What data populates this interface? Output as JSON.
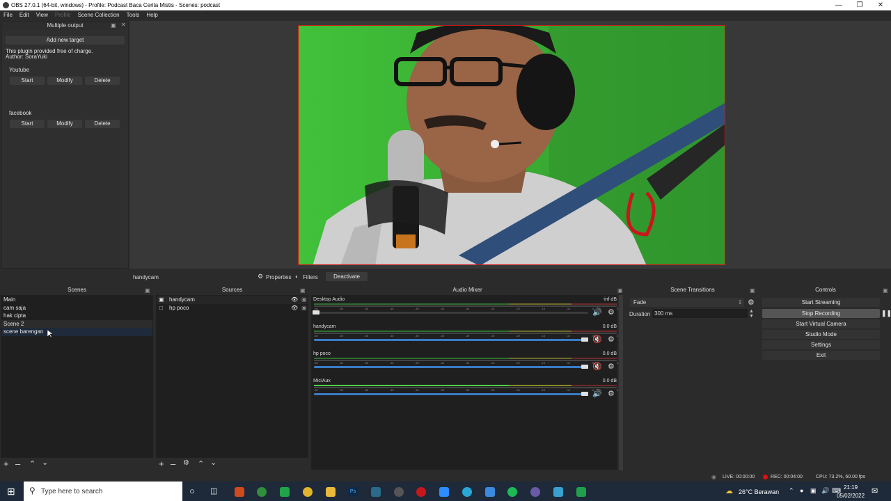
{
  "window": {
    "title": "OBS 27.0.1 (64-bit, windows) - Profile: Podcast Baca Cerita Mistis - Scenes: podcast"
  },
  "menu": {
    "items": [
      "File",
      "Edit",
      "View",
      "Profile",
      "Scene Collection",
      "Tools",
      "Help"
    ]
  },
  "multiple_output": {
    "title": "Multiple output",
    "add_label": "Add new target",
    "info_line1": "This plugin provided free of charge.",
    "info_line2": "Author: SoraYuki",
    "targets": [
      {
        "name": "Youtube",
        "start": "Start",
        "modify": "Modify",
        "delete": "Delete"
      },
      {
        "name": "facebook",
        "start": "Start",
        "modify": "Modify",
        "delete": "Delete"
      }
    ]
  },
  "source_toolbar": {
    "selected": "handycam",
    "properties": "Properties",
    "filters": "Filters",
    "deactivate": "Deactivate"
  },
  "scenes": {
    "title": "Scenes",
    "items": [
      "Main",
      "cam saja",
      "hak cipta",
      "Scene 2",
      "scene barengan"
    ]
  },
  "sources": {
    "title": "Sources",
    "items": [
      "handycam",
      "hp poco"
    ]
  },
  "mixer": {
    "title": "Audio Mixer",
    "channels": [
      {
        "name": "Desktop Audio",
        "db": "-inf dB",
        "level": 0.02,
        "muted": false
      },
      {
        "name": "handycam",
        "db": "0.0 dB",
        "level": 1.0,
        "muted": true
      },
      {
        "name": "hp poco",
        "db": "0.0 dB",
        "level": 1.0,
        "muted": true
      },
      {
        "name": "Mic/Aux",
        "db": "0.0 dB",
        "level": 1.0,
        "muted": false
      }
    ],
    "ticks": [
      "-60",
      "-55",
      "-50",
      "-45",
      "-40",
      "-35",
      "-30",
      "-25",
      "-20",
      "-15",
      "-10",
      "-5",
      "0"
    ]
  },
  "transitions": {
    "title": "Scene Transitions",
    "selected": "Fade",
    "duration_label": "Duration",
    "duration_value": "300 ms"
  },
  "controls": {
    "title": "Controls",
    "buttons": [
      "Start Streaming",
      "Stop Recording",
      "Start Virtual Camera",
      "Studio Mode",
      "Settings",
      "Exit"
    ]
  },
  "status": {
    "live": "LIVE: 00:00:00",
    "rec": "REC: 00:04:00",
    "cpu": "CPU: 73.2%, 60.00 fps"
  },
  "taskbar": {
    "search": "Type here to search",
    "weather": "26°C  Berawan",
    "time": "21:19",
    "date": "05/02/2022"
  }
}
